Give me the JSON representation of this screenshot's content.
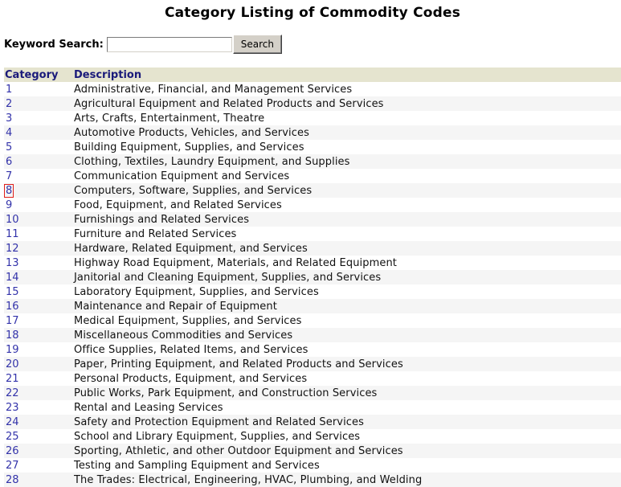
{
  "page": {
    "title": "Category Listing of Commodity Codes"
  },
  "search": {
    "label": "Keyword Search:",
    "value": "",
    "placeholder": "",
    "button_label": "Search"
  },
  "table": {
    "headers": {
      "category": "Category",
      "description": "Description"
    },
    "focused_category": "8",
    "rows": [
      {
        "category": "1",
        "description": "Administrative, Financial, and Management Services"
      },
      {
        "category": "2",
        "description": "Agricultural Equipment and Related Products and Services"
      },
      {
        "category": "3",
        "description": "Arts, Crafts, Entertainment, Theatre"
      },
      {
        "category": "4",
        "description": "Automotive Products, Vehicles, and Services"
      },
      {
        "category": "5",
        "description": "Building Equipment, Supplies, and Services"
      },
      {
        "category": "6",
        "description": "Clothing, Textiles, Laundry Equipment, and Supplies"
      },
      {
        "category": "7",
        "description": "Communication Equipment and Services"
      },
      {
        "category": "8",
        "description": "Computers, Software, Supplies, and Services"
      },
      {
        "category": "9",
        "description": "Food, Equipment, and Related Services"
      },
      {
        "category": "10",
        "description": "Furnishings and Related Services"
      },
      {
        "category": "11",
        "description": "Furniture and Related Services"
      },
      {
        "category": "12",
        "description": "Hardware, Related Equipment, and Services"
      },
      {
        "category": "13",
        "description": "Highway Road Equipment, Materials, and Related Equipment"
      },
      {
        "category": "14",
        "description": "Janitorial and Cleaning Equipment, Supplies, and Services"
      },
      {
        "category": "15",
        "description": "Laboratory Equipment, Supplies, and Services"
      },
      {
        "category": "16",
        "description": "Maintenance and Repair of Equipment"
      },
      {
        "category": "17",
        "description": "Medical Equipment, Supplies, and Services"
      },
      {
        "category": "18",
        "description": "Miscellaneous Commodities and Services"
      },
      {
        "category": "19",
        "description": "Office Supplies, Related Items, and Services"
      },
      {
        "category": "20",
        "description": "Paper, Printing Equipment, and Related Products and Services"
      },
      {
        "category": "21",
        "description": "Personal Products, Equipment, and Services"
      },
      {
        "category": "22",
        "description": "Public Works, Park Equipment, and Construction Services"
      },
      {
        "category": "23",
        "description": "Rental and Leasing Services"
      },
      {
        "category": "24",
        "description": "Safety and Protection Equipment and Related Services"
      },
      {
        "category": "25",
        "description": "School and Library Equipment, Supplies, and Services"
      },
      {
        "category": "26",
        "description": "Sporting, Athletic, and other Outdoor Equipment and Services"
      },
      {
        "category": "27",
        "description": "Testing and Sampling Equipment and Services"
      },
      {
        "category": "28",
        "description": "The Trades: Electrical, Engineering, HVAC, Plumbing, and Welding"
      }
    ]
  },
  "colors": {
    "header_bg": "#e5e4cf",
    "header_text": "#1a1a7a",
    "link": "#3333aa",
    "row_alt_bg": "#f5f5f5",
    "focus_outline": "#e0201c"
  }
}
